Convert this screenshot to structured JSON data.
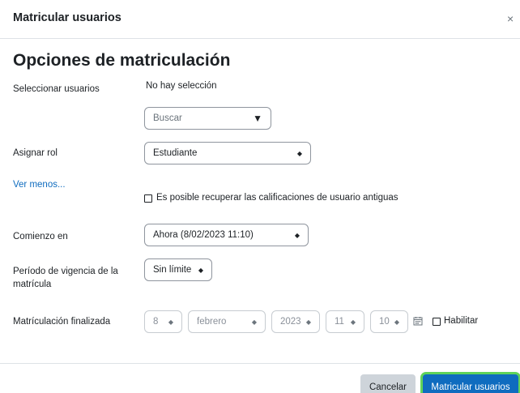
{
  "modal": {
    "title": "Matricular usuarios",
    "close_glyph": "×"
  },
  "section": {
    "title": "Opciones de matriculación"
  },
  "select_users": {
    "label": "Seleccionar usuarios",
    "selection_text": "No hay selección",
    "search_placeholder": "Buscar"
  },
  "role": {
    "label": "Asignar rol",
    "value": "Estudiante"
  },
  "show_less_link": "Ver menos...",
  "recover_grades": {
    "label": "Es posible recuperar las calificaciones de usuario antiguas",
    "checked": false
  },
  "start": {
    "label": "Comienzo en",
    "value": "Ahora (8/02/2023 11:10)"
  },
  "duration": {
    "label_line1": "Período de vigencia de la",
    "label_line2": "matrícula",
    "value": "Sin límite"
  },
  "end": {
    "label": "Matrículación finalizada",
    "day": "8",
    "month": "febrero",
    "year": "2023",
    "hour": "11",
    "minute": "10",
    "enable_label": "Habilitar",
    "enabled": false
  },
  "footer": {
    "cancel_label": "Cancelar",
    "submit_label": "Matricular usuarios"
  },
  "icons": {
    "close": "close-icon",
    "dropdown": "chevron-updown-icon",
    "search_dropdown": "caret-down-icon",
    "calendar": "calendar-icon"
  },
  "colors": {
    "primary": "#0f6cbf",
    "link": "#0f6cbf",
    "focus_ring": "#5fd35a",
    "cancel_bg": "#ced4da"
  }
}
